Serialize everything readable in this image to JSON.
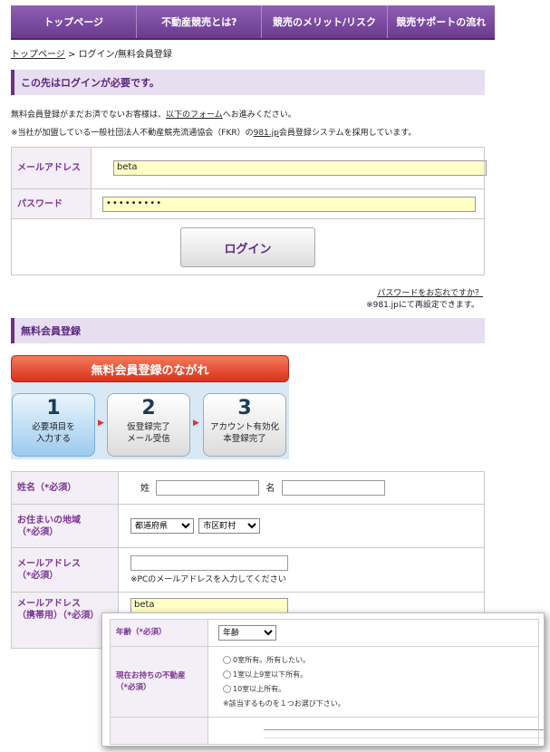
{
  "nav": {
    "items": [
      "トップページ",
      "不動産競売とは?",
      "競売のメリット/リスク",
      "競売サポートの流れ"
    ]
  },
  "breadcrumb": {
    "home": "トップページ",
    "separator": " > ",
    "current": "ログイン/無料会員登録"
  },
  "login_section": {
    "title": "この先はログインが必要です。",
    "intro_prefix": "無料会員登録がまだお済でないお客様は、",
    "intro_link": "以下のフォーム",
    "intro_suffix": "へお進みください。",
    "note_prefix": "※当社が加盟している一般社団法人不動産競売流通協会（FKR）の",
    "note_link": "981.jp",
    "note_suffix": "会員登録システムを採用しています。",
    "email_label": "メールアドレス",
    "email_value": "beta",
    "password_label": "パスワード",
    "password_value": "•••••••••",
    "login_button": "ログイン",
    "forgot_link": "パスワードをお忘れですか？",
    "reissue_note": "※981.jpにて再設定できます。"
  },
  "register_section": {
    "title": "無料会員登録",
    "flow_title": "無料会員登録のながれ",
    "steps": [
      {
        "num": "1",
        "line1": "必要項目を",
        "line2": "入力する"
      },
      {
        "num": "2",
        "line1": "仮登録完了",
        "line2": "メール受信"
      },
      {
        "num": "3",
        "line1": "アカウント有効化",
        "line2": "本登録完了"
      }
    ]
  },
  "register_form": {
    "name_label": "姓名（*必須）",
    "sei": "姓",
    "mei": "名",
    "address_label_1": "お住まいの地域",
    "address_label_2": "（*必須）",
    "prefecture_select": "都道府県",
    "city_select": "市区町村",
    "email_label_1": "メールアドレス",
    "email_label_2": "（*必須）",
    "email_note": "※PCのメールアドレスを入力してください",
    "mobile_label_1": "メールアドレス",
    "mobile_label_2": "（携帯用）（*必須）",
    "mobile_value": "beta"
  },
  "overlay": {
    "age_label": "年齢（*必須）",
    "age_select": "年齢",
    "property_label_1": "現在お持ちの不動産",
    "property_label_2": "（*必須）",
    "options": [
      "0室所有。所有したい。",
      "1室以上9室以下所有。",
      "10室以上所有。"
    ],
    "note": "※該当するものを１つお選び下さい。"
  },
  "colors": {
    "nav_bg": "#6f3d93",
    "accent": "#5c2680",
    "input_yellow": "#ffffc6",
    "label_bg": "#f4eef7"
  }
}
